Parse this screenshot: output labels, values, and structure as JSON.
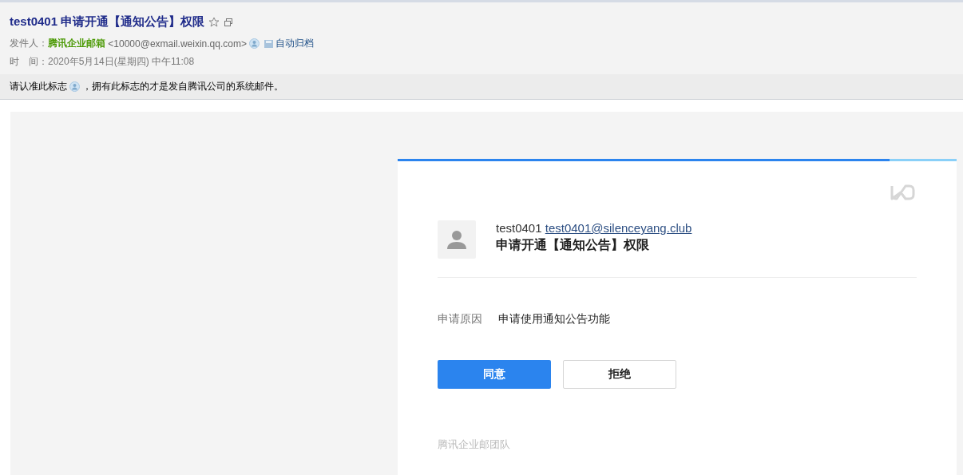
{
  "header": {
    "subject": "test0401 申请开通【通知公告】权限",
    "sender_label": "发件人：",
    "sender_name": "腾讯企业邮箱",
    "sender_address": "<10000@exmail.weixin.qq.com>",
    "archive_label": "自动归档",
    "time_label": "时　间：",
    "time_value": "2020年5月14日(星期四) 中午11:08"
  },
  "notice": {
    "before": "请认准此标志",
    "after": "，拥有此标志的才是发自腾讯公司的系统邮件。"
  },
  "card": {
    "requester_name": "test0401",
    "requester_email": "test0401@silenceyang.club",
    "title": "申请开通【通知公告】权限",
    "fields": [
      {
        "label": "申请原因",
        "value": "申请使用通知公告功能"
      }
    ],
    "buttons": [
      {
        "label": "同意",
        "kind": "primary"
      },
      {
        "label": "拒绝",
        "kind": "secondary"
      }
    ],
    "footer": "腾讯企业邮团队"
  }
}
